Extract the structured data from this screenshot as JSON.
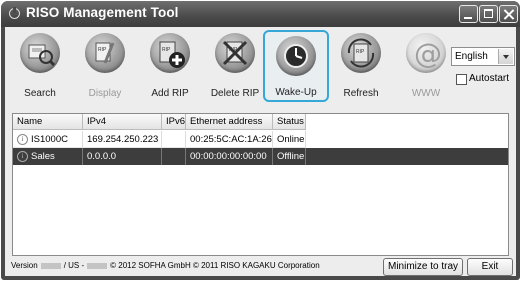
{
  "window": {
    "title": "RISO Management Tool"
  },
  "toolbar": {
    "buttons": [
      {
        "label": "Search",
        "icon": "search-icon",
        "enabled": true
      },
      {
        "label": "Display",
        "icon": "display-icon",
        "enabled": false
      },
      {
        "label": "Add RIP",
        "icon": "add-rip-icon",
        "enabled": true
      },
      {
        "label": "Delete RIP",
        "icon": "delete-rip-icon",
        "enabled": true
      },
      {
        "label": "Wake-Up",
        "icon": "wake-up-clock-icon",
        "enabled": true,
        "selected": true
      },
      {
        "label": "Refresh",
        "icon": "refresh-icon",
        "enabled": true
      },
      {
        "label": "WWW",
        "icon": "www-at-icon",
        "enabled": false
      }
    ],
    "language": "English",
    "autostart_label": "Autostart",
    "autostart_checked": false
  },
  "table": {
    "columns": [
      "Name",
      "IPv4",
      "IPv6",
      "Ethernet address",
      "Status"
    ],
    "rows": [
      {
        "name": "IS1000C",
        "ipv4": "169.254.250.223",
        "ipv6": "",
        "ethernet": "00:25:5C:AC:1A:26",
        "status": "Online",
        "selected": false
      },
      {
        "name": "Sales",
        "ipv4": "0.0.0.0",
        "ipv6": "",
        "ethernet": "00:00:00:00:00:00",
        "status": "Offline",
        "selected": true
      }
    ]
  },
  "footer": {
    "version_prefix": "Version",
    "version_mid": "/ US -",
    "copyright": "© 2012 SOFHA GmbH © 2011 RISO KAGAKU Corporation",
    "minimize_label": "Minimize to tray",
    "exit_label": "Exit"
  },
  "colors": {
    "accent": "#35a8d8",
    "titlebar": "#4a4a4a",
    "selected_row": "#3d3d3d"
  }
}
